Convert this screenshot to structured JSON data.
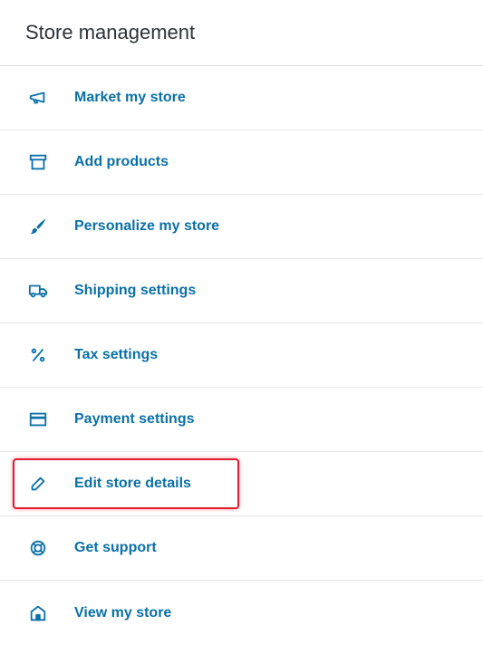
{
  "header": {
    "title": "Store management"
  },
  "items": [
    {
      "label": "Market my store",
      "icon": "megaphone-icon"
    },
    {
      "label": "Add products",
      "icon": "archive-box-icon"
    },
    {
      "label": "Personalize my store",
      "icon": "paintbrush-icon"
    },
    {
      "label": "Shipping settings",
      "icon": "truck-icon"
    },
    {
      "label": "Tax settings",
      "icon": "percent-icon"
    },
    {
      "label": "Payment settings",
      "icon": "credit-card-icon"
    },
    {
      "label": "Edit store details",
      "icon": "pencil-icon",
      "highlighted": true
    },
    {
      "label": "Get support",
      "icon": "lifebuoy-icon"
    },
    {
      "label": "View my store",
      "icon": "house-icon"
    }
  ],
  "colors": {
    "link": "#0a70a8",
    "highlight": "#e21b2d",
    "title": "#2c3338"
  }
}
